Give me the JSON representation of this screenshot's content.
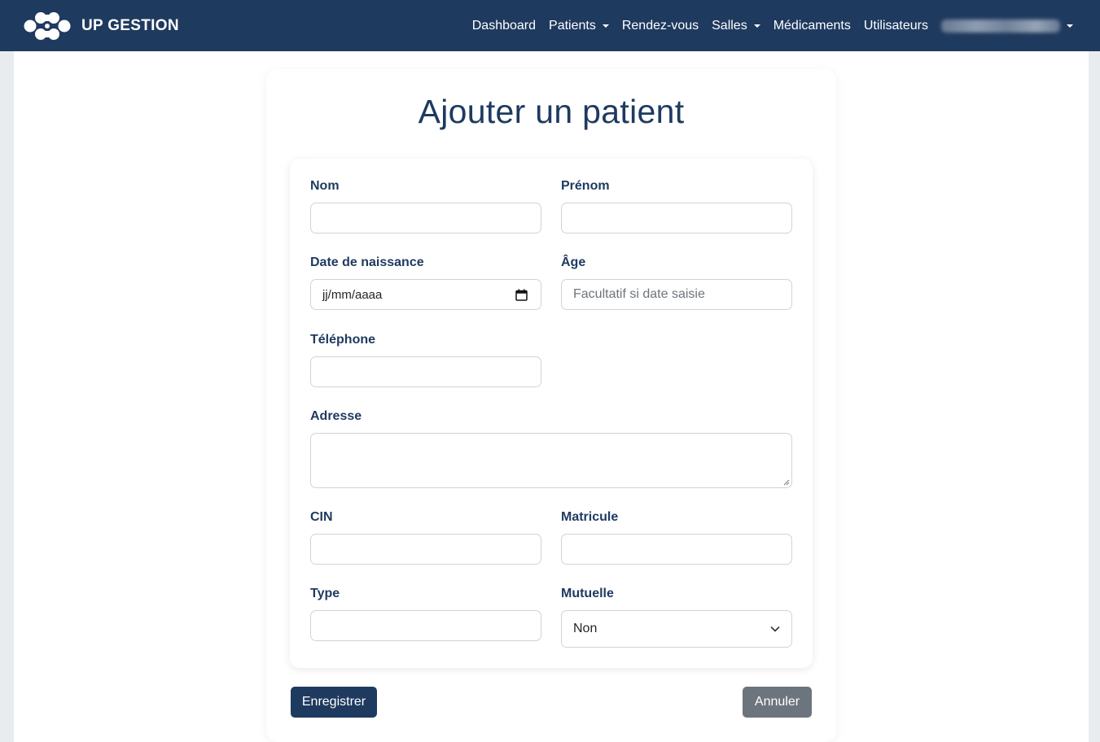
{
  "navbar": {
    "brand": "UP GESTION",
    "items": [
      {
        "label": "Dashboard",
        "dropdown": false
      },
      {
        "label": "Patients",
        "dropdown": true
      },
      {
        "label": "Rendez-vous",
        "dropdown": false
      },
      {
        "label": "Salles",
        "dropdown": true
      },
      {
        "label": "Médicaments",
        "dropdown": false
      },
      {
        "label": "Utilisateurs",
        "dropdown": false
      }
    ],
    "user_menu": {
      "dropdown": true
    }
  },
  "page": {
    "title": "Ajouter un patient"
  },
  "form": {
    "nom": {
      "label": "Nom",
      "value": ""
    },
    "prenom": {
      "label": "Prénom",
      "value": ""
    },
    "date_naissance": {
      "label": "Date de naissance",
      "value": "jj/mm/aaaa"
    },
    "age": {
      "label": "Âge",
      "placeholder": "Facultatif si date saisie"
    },
    "telephone": {
      "label": "Téléphone",
      "value": ""
    },
    "adresse": {
      "label": "Adresse",
      "value": ""
    },
    "cin": {
      "label": "CIN",
      "value": ""
    },
    "matricule": {
      "label": "Matricule",
      "value": ""
    },
    "type": {
      "label": "Type",
      "value": ""
    },
    "mutuelle": {
      "label": "Mutuelle",
      "selected": "Non"
    }
  },
  "actions": {
    "save": "Enregistrer",
    "cancel": "Annuler"
  },
  "colors": {
    "navbar": "#1f3a5f",
    "primary": "#1f3a5f",
    "secondary": "#6c757d",
    "label": "#1e3a5f"
  }
}
